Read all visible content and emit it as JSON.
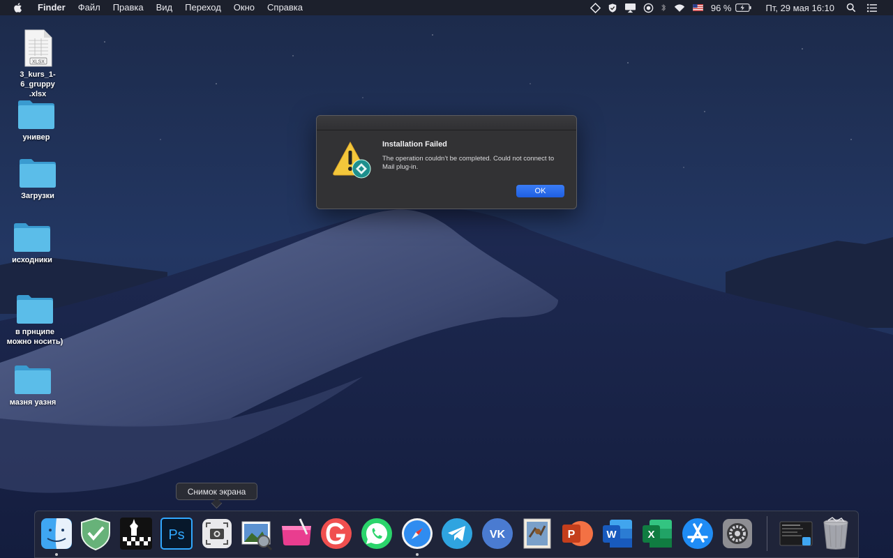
{
  "menubar": {
    "apple_icon": "apple-logo-icon",
    "app_name": "Finder",
    "menus": [
      "Файл",
      "Правка",
      "Вид",
      "Переход",
      "Окно",
      "Справка"
    ],
    "status": {
      "battery": "96 %",
      "clock": "Пт, 29 мая  16:10"
    }
  },
  "desktop": {
    "icons": [
      {
        "label": "3_kurs_1-6_gruppy\n.xlsx",
        "label_line1": "3_kurs_1-6_gruppy",
        "label_line2": ".xlsx",
        "badge": "XLSX",
        "type": "file"
      },
      {
        "label": "универ",
        "type": "folder"
      },
      {
        "label": "Загрузки",
        "type": "folder"
      },
      {
        "label": "исходники",
        "type": "folder"
      },
      {
        "label_line1": "в прнципе",
        "label_line2": "можно носить)",
        "type": "folder"
      },
      {
        "label": "мазня уазня",
        "type": "folder"
      }
    ]
  },
  "alert": {
    "title": "Installation Failed",
    "message": "The operation couldn’t be completed. Could not connect to Mail plug-in.",
    "ok_label": "OK"
  },
  "tooltip": {
    "text": "Снимок экрана"
  },
  "dock": {
    "items": [
      "finder-icon",
      "adguard-icon",
      "chess-icon",
      "photoshop-icon",
      "screenshot-icon",
      "preview-icon",
      "cleanmymac-icon",
      "grammarly-icon",
      "whatsapp-icon",
      "safari-icon",
      "telegram-icon",
      "vk-icon",
      "mail-icon",
      "powerpoint-icon",
      "word-icon",
      "excel-icon",
      "app-store-icon",
      "system-preferences-icon",
      "recent-window-icon",
      "trash-icon"
    ],
    "ps_label": "Ps",
    "ppt_letter": "P",
    "word_letter": "W",
    "excel_letter": "X",
    "vk_label": "VK"
  },
  "colors": {
    "accent": "#1f5fe0",
    "folder": "#4fb6e6",
    "alert_bg": "#323234"
  }
}
